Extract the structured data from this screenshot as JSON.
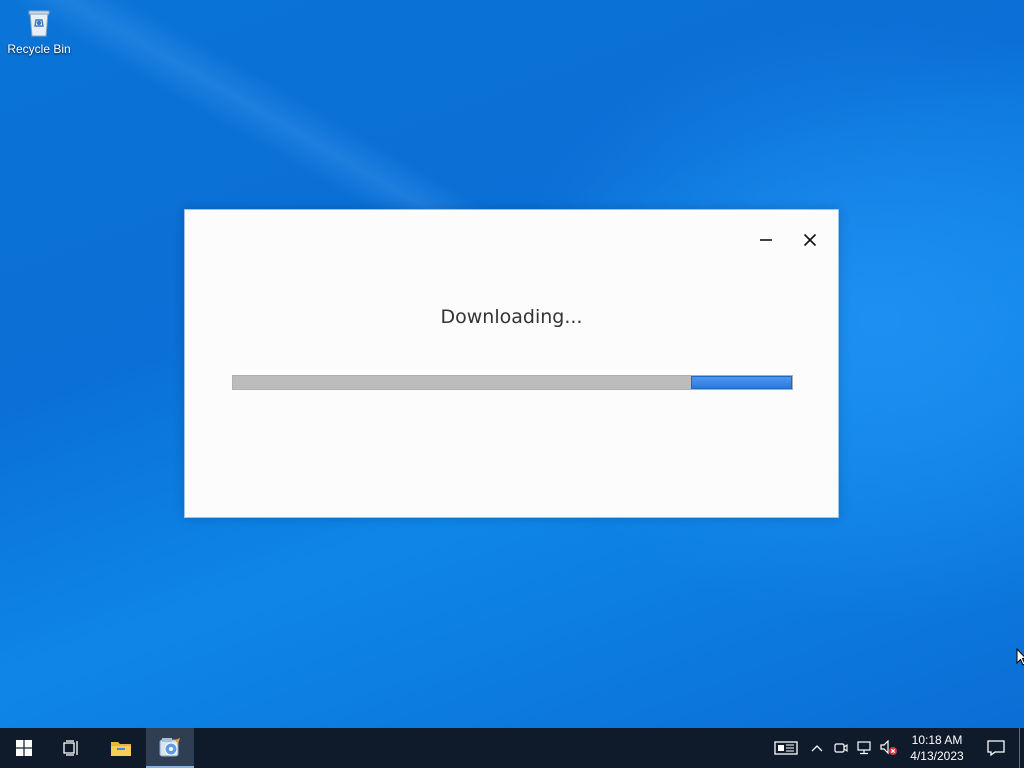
{
  "desktop": {
    "icons": [
      {
        "label": "Recycle Bin",
        "icon": "recycle-bin-icon"
      }
    ]
  },
  "dialog": {
    "title": "Downloading...",
    "progress": {
      "fraction_start": 0.82,
      "fraction_end": 1.0,
      "mode": "indeterminate"
    },
    "buttons": {
      "minimize": "minimize-icon",
      "close": "close-icon"
    }
  },
  "taskbar": {
    "items": [
      "start-icon",
      "task-view-icon",
      "file-explorer-icon",
      "setup-app-icon"
    ],
    "tray": [
      "news-icon",
      "chevron-up-icon",
      "meet-icon",
      "network-icon",
      "volume-muted-icon"
    ],
    "clock": {
      "time": "10:18 AM",
      "date": "4/13/2023"
    },
    "notification": "action-center-icon"
  },
  "colors": {
    "accent": "#2b79e0",
    "taskbar": "#0f1b2b",
    "dialog_bg": "#fcfcfc",
    "track": "#bcbcbc"
  }
}
